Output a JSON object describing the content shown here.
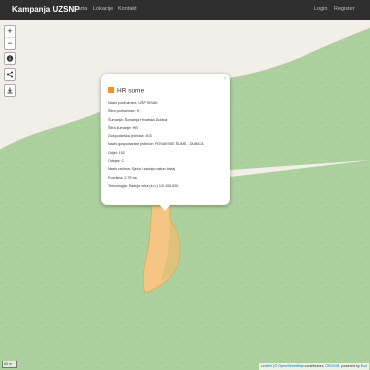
{
  "navbar": {
    "brand": "Kampanja UZSNP",
    "left_links": [
      "Karta",
      "Lokacije",
      "Kontakt"
    ],
    "right_links": [
      "Login",
      "Register"
    ]
  },
  "map_controls": {
    "zoom_in": "+",
    "zoom_out": "−",
    "icons": [
      "info-icon",
      "share-icon",
      "download-icon"
    ]
  },
  "popup": {
    "close": "×",
    "title": "HR sume",
    "color": "#f0922a",
    "rows": [
      "Naziv podružnice: UŠP SISAK",
      "Šifra podružnice: H",
      "Šumarija: Šumarija Hrvatska Dubica",
      "Šifra šumarije: HB",
      "Gospodarska jedinica: 403",
      "Naziv gospodarske jedinice: POSAVSKE ŠUME - DUBICA",
      "Odjel: 152",
      "Odsjek: C",
      "Naziv radova: Sječa i sadnja nakon čistaj",
      "Površina: 2.75 ha",
      "Tehnologija: Sadnja vrba (s.n.) 1/0 150.000"
    ]
  },
  "scale": "50 m",
  "attribution": {
    "leaflet": "Leaflet",
    "sep": " | © ",
    "osm": "OpenStreetMap",
    "contrib": " contributors, ",
    "crosis": "CROSIS",
    "powered": ", powered by ",
    "esri": "Esri"
  },
  "colors": {
    "forest": "#add19e",
    "landuse": "#f2efe9",
    "polygon": "#f5c683",
    "polygon_stroke": "#e6a24e",
    "navbar": "#2f2f2f"
  }
}
